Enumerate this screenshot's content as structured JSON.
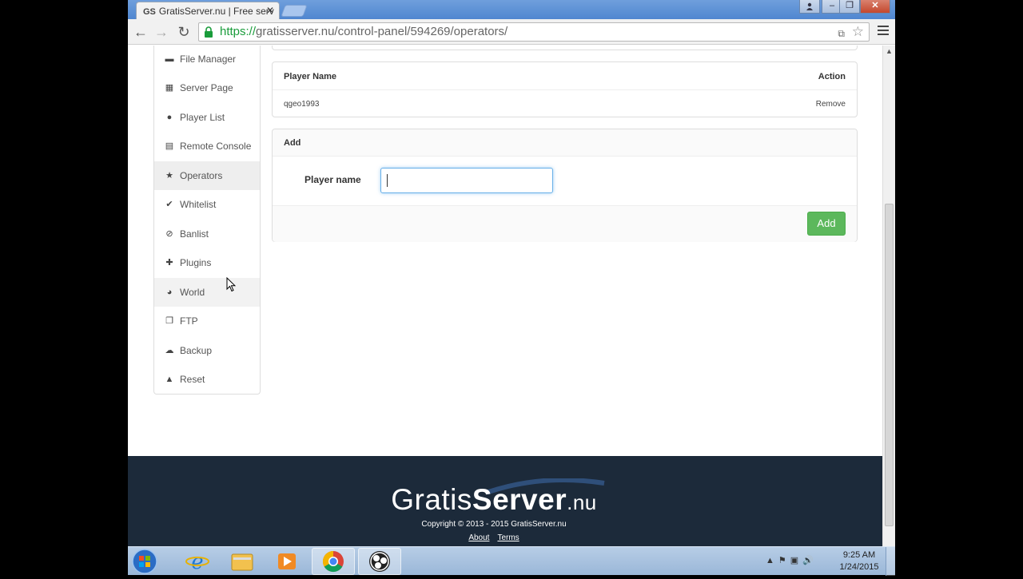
{
  "browser": {
    "tab_title": "GratisServer.nu | Free serv",
    "tab_badge": "GS",
    "url_scheme": "https://",
    "url_rest": "gratisserver.nu/control-panel/594269/operators/"
  },
  "sidebar": {
    "items": [
      {
        "label": "File Manager",
        "icon": "folder-open-icon",
        "glyph": "▬"
      },
      {
        "label": "Server Page",
        "icon": "grid-icon",
        "glyph": "▦"
      },
      {
        "label": "Player List",
        "icon": "user-icon",
        "glyph": "●"
      },
      {
        "label": "Remote Console",
        "icon": "console-icon",
        "glyph": "▤"
      },
      {
        "label": "Operators",
        "icon": "star-icon",
        "glyph": "★"
      },
      {
        "label": "Whitelist",
        "icon": "check-icon",
        "glyph": "✔"
      },
      {
        "label": "Banlist",
        "icon": "ban-icon",
        "glyph": "⊘"
      },
      {
        "label": "Plugins",
        "icon": "plus-icon",
        "glyph": "✚"
      },
      {
        "label": "World",
        "icon": "globe-icon",
        "glyph": "◕"
      },
      {
        "label": "FTP",
        "icon": "files-icon",
        "glyph": "❐"
      },
      {
        "label": "Backup",
        "icon": "cloud-upload-icon",
        "glyph": "☁"
      },
      {
        "label": "Reset",
        "icon": "warning-icon",
        "glyph": "▲"
      }
    ],
    "active": "Operators"
  },
  "operators": {
    "col_player": "Player Name",
    "col_action": "Action",
    "rows": [
      {
        "name": "qgeo1993",
        "action": "Remove"
      }
    ]
  },
  "add_form": {
    "heading": "Add",
    "field_label": "Player name",
    "field_value": "",
    "button_label": "Add",
    "button_color": "#5cb85c"
  },
  "footer": {
    "logo_light": "Gratis",
    "logo_bold": "Server",
    "logo_tld": ".nu",
    "copyright": "Copyright © 2013 - 2015 GratisServer.nu",
    "link_about": "About",
    "link_terms": "Terms",
    "background": "#1c2a3a"
  },
  "taskbar": {
    "time": "9:25 AM",
    "date": "1/24/2015",
    "apps": [
      "start-orb",
      "internet-explorer-icon",
      "file-explorer-icon",
      "media-player-icon",
      "chrome-icon",
      "obs-icon"
    ]
  }
}
